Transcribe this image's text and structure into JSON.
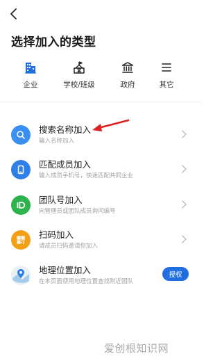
{
  "page": {
    "title": "选择加入的类型"
  },
  "tabs": [
    {
      "label": "企业",
      "icon": "building-icon"
    },
    {
      "label": "学校/班级",
      "icon": "school-icon"
    },
    {
      "label": "政府",
      "icon": "government-icon"
    },
    {
      "label": "其它",
      "icon": "menu-icon"
    }
  ],
  "items": [
    {
      "title": "搜索名称加入",
      "sub": "输入名称加入",
      "icon": "search-icon",
      "color": "#3b8ff0"
    },
    {
      "title": "匹配成员加入",
      "sub": "输入成员手机号，快速匹配共同企业",
      "icon": "phone-icon",
      "color": "#2f7fe8"
    },
    {
      "title": "团队号加入",
      "sub": "向管理员或团队成员询问编号",
      "icon": "id-icon",
      "color": "#2db34e"
    },
    {
      "title": "扫码加入",
      "sub": "请成员扫码邀请你加入",
      "icon": "qrcode-icon",
      "color": "#f3a017"
    },
    {
      "title": "地理位置加入",
      "sub": "在本页面使用地理位置查找附近团队",
      "icon": "location-icon",
      "button": "授权"
    }
  ],
  "colors": {
    "accent": "#1f6fe0",
    "annotation": "#e02020"
  },
  "watermark": "爱创根知识网"
}
